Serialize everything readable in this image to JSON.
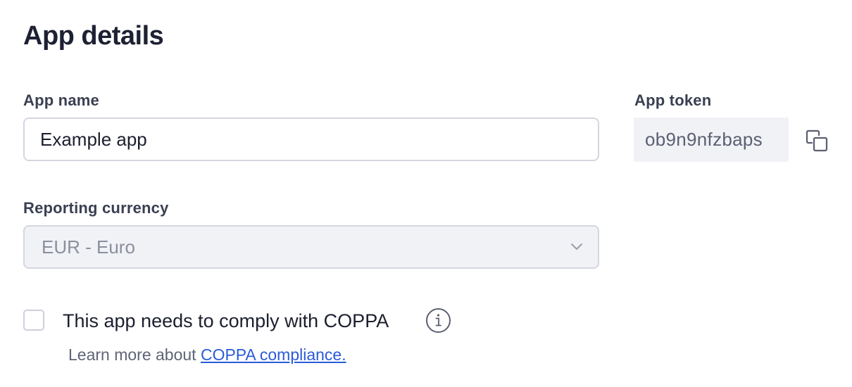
{
  "page": {
    "title": "App details"
  },
  "app_name": {
    "label": "App name",
    "value": "Example app"
  },
  "app_token": {
    "label": "App token",
    "value": "ob9n9nfzbaps",
    "copy_icon": "copy-icon"
  },
  "reporting_currency": {
    "label": "Reporting currency",
    "selected": "EUR - Euro",
    "icon": "chevron-down-icon"
  },
  "coppa": {
    "checkbox_label": "This app needs to comply with COPPA",
    "checked": false,
    "info_icon": "info-icon",
    "helper_prefix": "Learn more about ",
    "helper_link": "COPPA compliance."
  },
  "colors": {
    "link": "#2a5bd7",
    "title": "#1e2133",
    "label": "#3a3f52",
    "disabled_bg": "#f1f2f6",
    "border": "#d4d6e0"
  }
}
